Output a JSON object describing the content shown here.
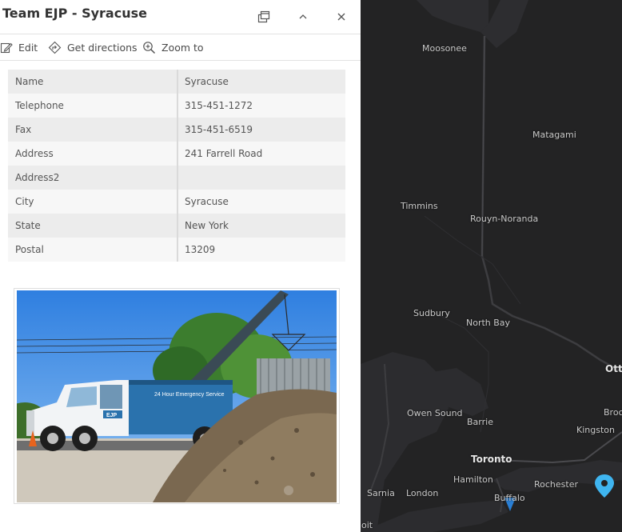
{
  "popup": {
    "title": "Team EJP - Syracuse",
    "toolbar": {
      "edit": "Edit",
      "directions": "Get directions",
      "zoom": "Zoom to"
    },
    "fields": [
      {
        "key": "Name",
        "value": "Syracuse"
      },
      {
        "key": "Telephone",
        "value": "315-451-1272"
      },
      {
        "key": "Fax",
        "value": "315-451-6519"
      },
      {
        "key": "Address",
        "value": "241 Farrell Road"
      },
      {
        "key": "Address2",
        "value": ""
      },
      {
        "key": "City",
        "value": "Syracuse"
      },
      {
        "key": "State",
        "value": "New York"
      },
      {
        "key": "Postal",
        "value": "13209"
      }
    ],
    "photo": {
      "truck_text": "24 Hour Emergency Service",
      "truck_logo": "EJP"
    }
  },
  "map": {
    "labels": {
      "moosonee": "Moosonee",
      "matagami": "Matagami",
      "timmins": "Timmins",
      "rouyn": "Rouyn-Noranda",
      "sudbury": "Sudbury",
      "northbay": "North Bay",
      "ottawa": "Ott",
      "owensound": "Owen Sound",
      "barrie": "Barrie",
      "brock": "Broc",
      "kingston": "Kingston",
      "toronto": "Toronto",
      "hamilton": "Hamilton",
      "rochester": "Rochester",
      "sarnia": "Sarnia",
      "london": "London",
      "buffalo": "Buffalo",
      "detroit": "oit"
    },
    "colors": {
      "pin": "#3fb5f0",
      "pin_alt": "#2a7fd4",
      "background": "#232324",
      "water": "#303033"
    }
  }
}
